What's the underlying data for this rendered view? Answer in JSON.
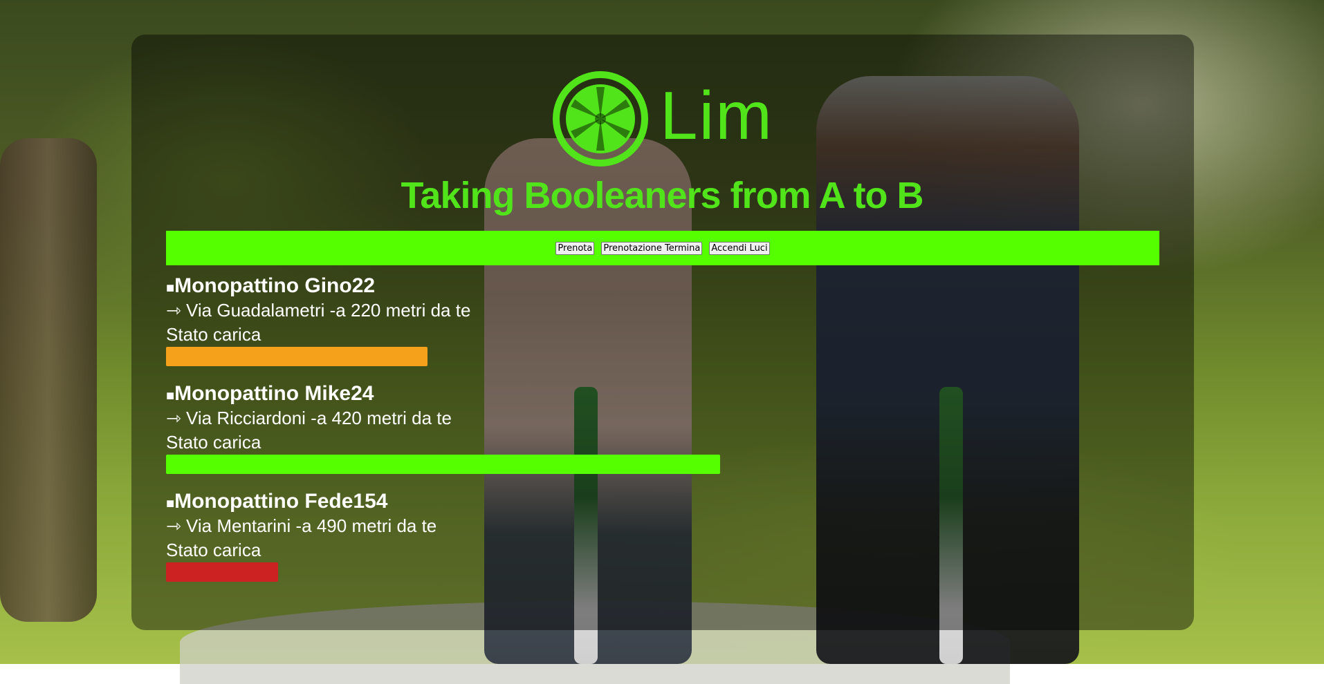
{
  "brand": {
    "logo_text": "Lim",
    "tagline": "Taking Booleaners from A to B",
    "color": "#52e41a"
  },
  "actions": {
    "book_label": "Prenota",
    "end_booking_label": "Prenotazione Termina",
    "lights_label": "Accendi Luci",
    "bar_color": "#55ff00"
  },
  "scooters": [
    {
      "bullet": "■",
      "name": "Monopattino Gino22",
      "location": "⇾ Via Guadalametri -a 220 metri da te",
      "charge_label": "Stato carica",
      "charge_fraction": 0.42,
      "charge_color": "#f5a11c"
    },
    {
      "bullet": "■",
      "name": "Monopattino Mike24",
      "location": "⇾ Via Ricciardoni -a 420 metri da te",
      "charge_label": "Stato carica",
      "charge_fraction": 0.89,
      "charge_color": "#55ff00"
    },
    {
      "bullet": "■",
      "name": "Monopattino Fede154",
      "location": "⇾ Via Mentarini -a 490 metri da te",
      "charge_label": "Stato carica",
      "charge_fraction": 0.18,
      "charge_color": "#cc2222"
    }
  ]
}
